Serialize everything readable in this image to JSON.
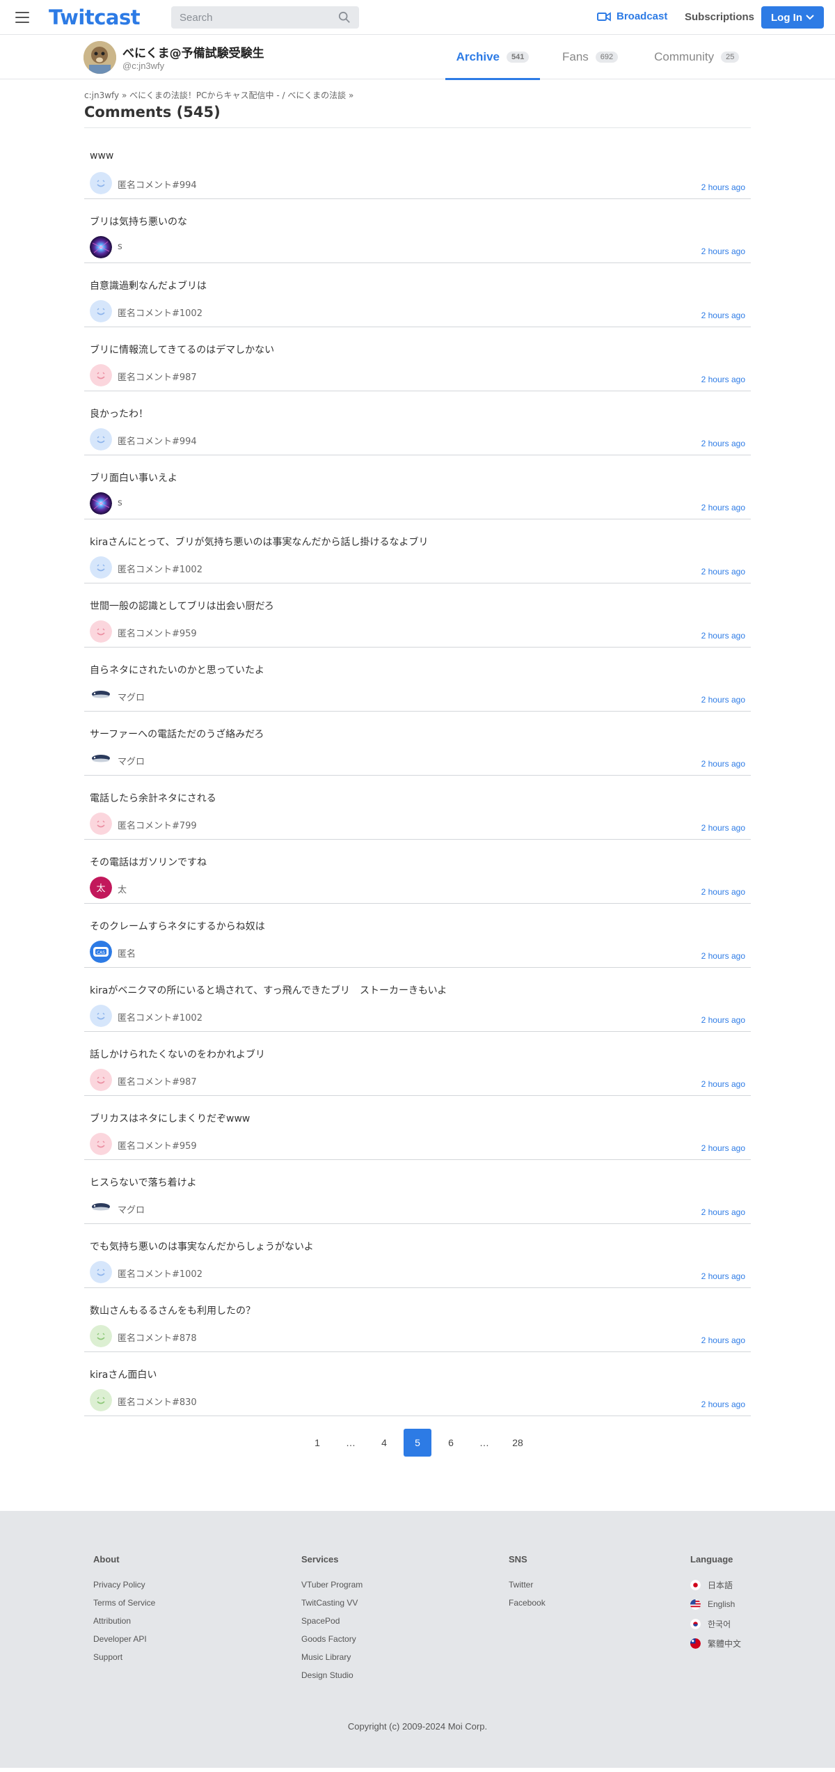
{
  "header": {
    "logo": "Twitcast",
    "search_placeholder": "Search",
    "broadcast_label": "Broadcast",
    "subscriptions_label": "Subscriptions",
    "login_label": "Log In",
    "accent_color": "#2d7be5"
  },
  "profile": {
    "name": "べにくま@予備試験受験生",
    "handle": "@c:jn3wfy",
    "tabs": [
      {
        "label": "Archive",
        "count": "541"
      },
      {
        "label": "Fans",
        "count": "692"
      },
      {
        "label": "Community",
        "count": "25"
      }
    ]
  },
  "breadcrumb": {
    "user": "c:jn3wfy",
    "sep1": "»",
    "movie": "べにくまの法談！PCからキャス配信中 - / べにくまの法談",
    "sep2": "»"
  },
  "page_title": "Comments (545)",
  "comments": [
    {
      "text": "www",
      "author": "匿名コメント#994",
      "time": "2 hours ago",
      "avatar": "anon-blue"
    },
    {
      "text": "ブリは気持ち悪いのな",
      "author": "s",
      "time": "2 hours ago",
      "avatar": "galaxy"
    },
    {
      "text": "自意識過剰なんだよブリは",
      "author": "匿名コメント#1002",
      "time": "2 hours ago",
      "avatar": "anon-blue"
    },
    {
      "text": "ブリに情報流してきてるのはデマしかない",
      "author": "匿名コメント#987",
      "time": "2 hours ago",
      "avatar": "anon-pink"
    },
    {
      "text": "良かったわ！",
      "author": "匿名コメント#994",
      "time": "2 hours ago",
      "avatar": "anon-blue"
    },
    {
      "text": "ブリ面白い事いえよ",
      "author": "s",
      "time": "2 hours ago",
      "avatar": "galaxy"
    },
    {
      "text": "kiraさんにとって、ブリが気持ち悪いのは事実なんだから話し掛けるなよブリ",
      "author": "匿名コメント#1002",
      "time": "2 hours ago",
      "avatar": "anon-blue"
    },
    {
      "text": "世間一般の認識としてブリは出会い厨だろ",
      "author": "匿名コメント#959",
      "time": "2 hours ago",
      "avatar": "anon-pink"
    },
    {
      "text": "自らネタにされたいのかと思っていたよ",
      "author": "マグロ",
      "time": "2 hours ago",
      "avatar": "tuna"
    },
    {
      "text": "サーファーへの電話ただのうざ絡みだろ",
      "author": "マグロ",
      "time": "2 hours ago",
      "avatar": "tuna"
    },
    {
      "text": "電話したら余計ネタにされる",
      "author": "匿名コメント#799",
      "time": "2 hours ago",
      "avatar": "anon-pink"
    },
    {
      "text": "その電話はガソリンですね",
      "author": "太",
      "time": "2 hours ago",
      "avatar": "kanji"
    },
    {
      "text": "そのクレームすらネタにするからね奴は",
      "author": "匿名",
      "time": "2 hours ago",
      "avatar": "cas"
    },
    {
      "text": "kiraがベニクマの所にいると堝されて、すっ飛んできたブリ　ストーカーきもいよ",
      "author": "匿名コメント#1002",
      "time": "2 hours ago",
      "avatar": "anon-blue"
    },
    {
      "text": "話しかけられたくないのをわかれよブリ",
      "author": "匿名コメント#987",
      "time": "2 hours ago",
      "avatar": "anon-pink"
    },
    {
      "text": "ブリカスはネタにしまくりだぞwww",
      "author": "匿名コメント#959",
      "time": "2 hours ago",
      "avatar": "anon-pink"
    },
    {
      "text": "ヒスらないで落ち着けよ",
      "author": "マグロ",
      "time": "2 hours ago",
      "avatar": "tuna"
    },
    {
      "text": "でも気持ち悪いのは事実なんだからしょうがないよ",
      "author": "匿名コメント#1002",
      "time": "2 hours ago",
      "avatar": "anon-blue"
    },
    {
      "text": "数山さんもるるさんをも利用したの？",
      "author": "匿名コメント#878",
      "time": "2 hours ago",
      "avatar": "anon-green"
    },
    {
      "text": "kiraさん面白い",
      "author": "匿名コメント#830",
      "time": "2 hours ago",
      "avatar": "anon-green"
    }
  ],
  "kanji_avatar_text": "太",
  "cas_avatar_text": "CAS",
  "pagination": [
    "1",
    "…",
    "4",
    "5",
    "6",
    "…",
    "28"
  ],
  "pagination_active": "5",
  "footer": {
    "about": {
      "heading": "About",
      "links": [
        "Privacy Policy",
        "Terms of Service",
        "Attribution",
        "Developer API",
        "Support"
      ]
    },
    "services": {
      "heading": "Services",
      "links": [
        "VTuber Program",
        "TwitCasting VV",
        "SpacePod",
        "Goods Factory",
        "Music Library",
        "Design Studio"
      ]
    },
    "sns": {
      "heading": "SNS",
      "links": [
        "Twitter",
        "Facebook"
      ]
    },
    "language": {
      "heading": "Language",
      "links": [
        "日本語",
        "English",
        "한국어",
        "繁體中文"
      ]
    },
    "copyright": "Copyright (c) 2009-2024 Moi Corp."
  }
}
